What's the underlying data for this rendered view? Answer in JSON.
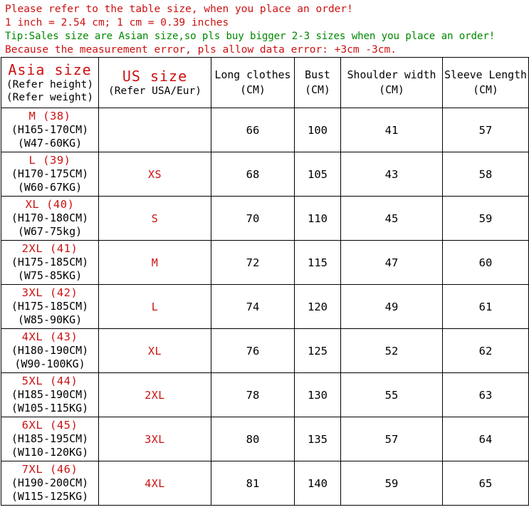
{
  "notice": {
    "line1": "Please refer to the table size, when you place an order!",
    "line2": "1 inch = 2.54 cm; 1 cm = 0.39 inches",
    "line3": "Tip:Sales size are Asian size,so pls buy bigger 2-3 sizes when you place an order!",
    "line4": "Because the measurement error, pls allow data error: +3cm -3cm.",
    "colors": {
      "red": "#cc1111",
      "green": "#008800"
    }
  },
  "table": {
    "headers": {
      "asia": {
        "title": "Asia size",
        "sub1": "(Refer height)",
        "sub2": "(Refer weight)"
      },
      "us": {
        "title": "US size",
        "sub1": "(Refer USA/Eur)"
      },
      "long_clothes": {
        "title": "Long clothes",
        "unit": "(CM)"
      },
      "bust": {
        "title": "Bust",
        "unit": "(CM)"
      },
      "shoulder": {
        "title": "Shoulder width",
        "unit": "(CM)"
      },
      "sleeve": {
        "title": "Sleeve Length",
        "unit": "(CM)"
      }
    },
    "rows": [
      {
        "asia_size": "M (38)",
        "asia_height": "(H165-170CM)",
        "asia_weight": "(W47-60KG)",
        "us_size": "",
        "long_clothes": "66",
        "bust": "100",
        "shoulder": "41",
        "sleeve": "57"
      },
      {
        "asia_size": "L (39)",
        "asia_height": "(H170-175CM)",
        "asia_weight": "(W60-67KG)",
        "us_size": "XS",
        "long_clothes": "68",
        "bust": "105",
        "shoulder": "43",
        "sleeve": "58"
      },
      {
        "asia_size": "XL (40)",
        "asia_height": "(H170-180CM)",
        "asia_weight": "(W67-75kg)",
        "us_size": "S",
        "long_clothes": "70",
        "bust": "110",
        "shoulder": "45",
        "sleeve": "59"
      },
      {
        "asia_size": "2XL (41)",
        "asia_height": "(H175-185CM)",
        "asia_weight": "(W75-85KG)",
        "us_size": "M",
        "long_clothes": "72",
        "bust": "115",
        "shoulder": "47",
        "sleeve": "60"
      },
      {
        "asia_size": "3XL (42)",
        "asia_height": "(H175-185CM)",
        "asia_weight": "(W85-90KG)",
        "us_size": "L",
        "long_clothes": "74",
        "bust": "120",
        "shoulder": "49",
        "sleeve": "61"
      },
      {
        "asia_size": "4XL (43)",
        "asia_height": "(H180-190CM)",
        "asia_weight": "(W90-100KG)",
        "us_size": "XL",
        "long_clothes": "76",
        "bust": "125",
        "shoulder": "52",
        "sleeve": "62"
      },
      {
        "asia_size": "5XL (44)",
        "asia_height": "(H185-190CM)",
        "asia_weight": "(W105-115KG)",
        "us_size": "2XL",
        "long_clothes": "78",
        "bust": "130",
        "shoulder": "55",
        "sleeve": "63"
      },
      {
        "asia_size": "6XL (45)",
        "asia_height": "(H185-195CM)",
        "asia_weight": "(W110-120KG)",
        "us_size": "3XL",
        "long_clothes": "80",
        "bust": "135",
        "shoulder": "57",
        "sleeve": "64"
      },
      {
        "asia_size": "7XL (46)",
        "asia_height": "(H190-200CM)",
        "asia_weight": "(W115-125KG)",
        "us_size": "4XL",
        "long_clothes": "81",
        "bust": "140",
        "shoulder": "59",
        "sleeve": "65"
      }
    ]
  }
}
